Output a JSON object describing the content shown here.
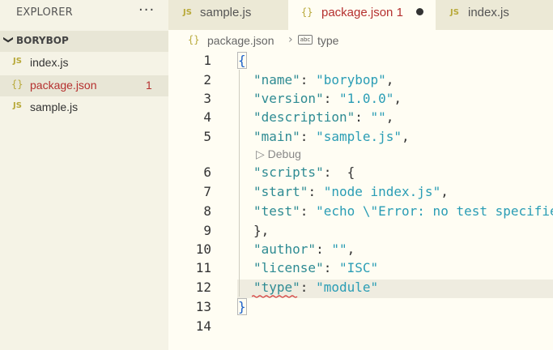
{
  "sidebar": {
    "title": "EXPLORER",
    "more": "···",
    "folder": {
      "chevron": "❯",
      "name": "BORYBOP"
    },
    "files": [
      {
        "icon": "JS",
        "name": "index.js",
        "badge": ""
      },
      {
        "icon": "{}",
        "name": "package.json",
        "badge": "1"
      },
      {
        "icon": "JS",
        "name": "sample.js",
        "badge": ""
      }
    ]
  },
  "tabs": [
    {
      "icon": "JS",
      "label": "sample.js"
    },
    {
      "icon": "{}",
      "label": "package.json 1"
    },
    {
      "icon": "JS",
      "label": "index.js"
    }
  ],
  "breadcrumb": {
    "icon": "{}",
    "file": "package.json",
    "sep": "›",
    "type_icon": "abc",
    "symbol": "type"
  },
  "editor": {
    "codelens": "▷ Debug",
    "lines": [
      {
        "n": "1",
        "key": "",
        "val": "",
        "raw": "{"
      },
      {
        "n": "2",
        "key": "\"name\"",
        "val": "\"borybop\"",
        "tail": ","
      },
      {
        "n": "3",
        "key": "\"version\"",
        "val": "\"1.0.0\"",
        "tail": ","
      },
      {
        "n": "4",
        "key": "\"description\"",
        "val": "\"\"",
        "tail": ","
      },
      {
        "n": "5",
        "key": "\"main\"",
        "val": "\"sample.js\"",
        "tail": ","
      },
      {
        "n": "6",
        "key": "\"scripts\"",
        "val": "",
        "tail": " {"
      },
      {
        "n": "7",
        "key": "\"start\"",
        "val": "\"node index.js\"",
        "tail": ","
      },
      {
        "n": "8",
        "key": "\"test\"",
        "val": "\"echo \\\"Error: no test specifie",
        "tail": ""
      },
      {
        "n": "9",
        "key": "",
        "val": "",
        "raw": "},"
      },
      {
        "n": "10",
        "key": "\"author\"",
        "val": "\"\"",
        "tail": ","
      },
      {
        "n": "11",
        "key": "\"license\"",
        "val": "\"ISC\"",
        "tail": ""
      },
      {
        "n": "12",
        "key": "\"type\"",
        "val": "\"module\"",
        "tail": ""
      },
      {
        "n": "13",
        "key": "",
        "val": "",
        "raw": "}"
      },
      {
        "n": "14",
        "key": "",
        "val": "",
        "raw": ""
      }
    ]
  },
  "colors": {
    "accent_error": "#b5302f",
    "editor_bg": "#fffdf3",
    "sidebar_bg": "#f5f3e6",
    "string": "#2a9db5",
    "key": "#2e8b93"
  }
}
